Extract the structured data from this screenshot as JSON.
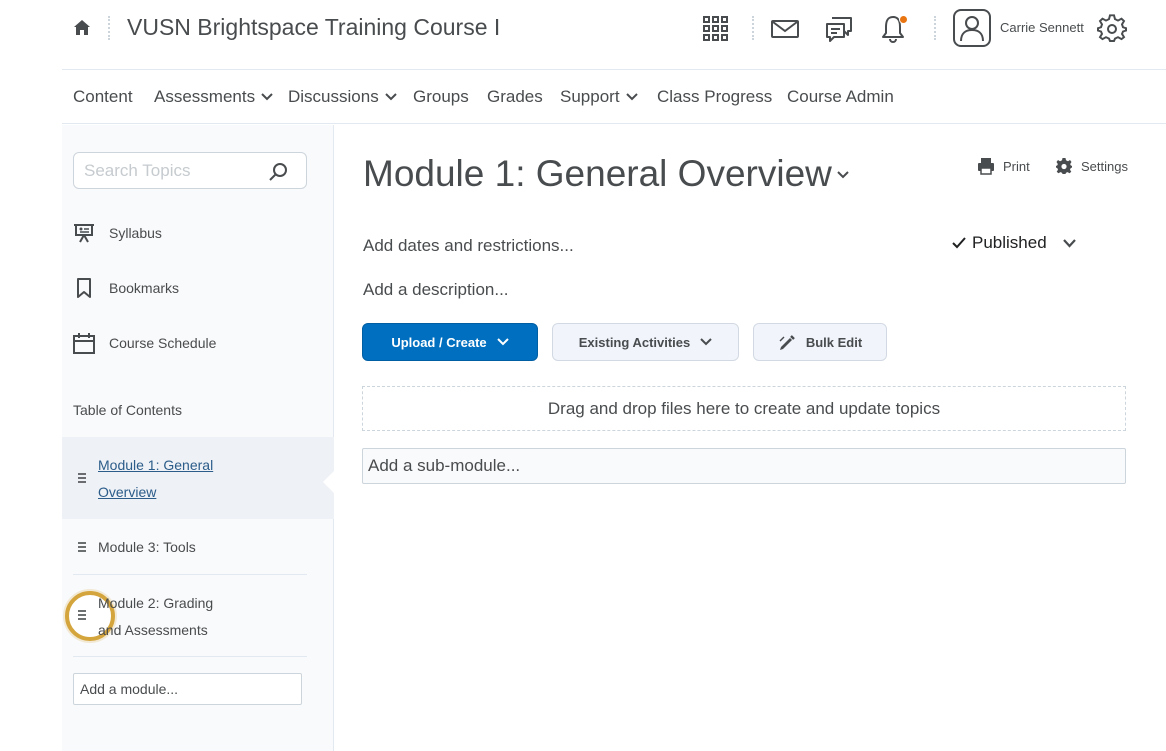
{
  "header": {
    "course_title": "VUSN Brightspace Training Course I",
    "user_name": "Carrie Sennett",
    "notification_color": "#e87511"
  },
  "nav": {
    "items": [
      {
        "label": "Content",
        "has_dropdown": false
      },
      {
        "label": "Assessments",
        "has_dropdown": true
      },
      {
        "label": "Discussions",
        "has_dropdown": true
      },
      {
        "label": "Groups",
        "has_dropdown": false
      },
      {
        "label": "Grades",
        "has_dropdown": false
      },
      {
        "label": "Support",
        "has_dropdown": true
      },
      {
        "label": "Class Progress",
        "has_dropdown": false
      },
      {
        "label": "Course Admin",
        "has_dropdown": false
      }
    ]
  },
  "sidebar": {
    "search_placeholder": "Search Topics",
    "links": [
      {
        "label": "Syllabus",
        "icon": "presentation-icon"
      },
      {
        "label": "Bookmarks",
        "icon": "bookmark-icon"
      },
      {
        "label": "Course Schedule",
        "icon": "calendar-icon"
      }
    ],
    "toc_label": "Table of Contents",
    "modules": [
      {
        "label": "Module 1: General Overview",
        "active": true
      },
      {
        "label": "Module 3: Tools",
        "active": false
      },
      {
        "label": "Module 2: Grading and Assessments",
        "active": false
      }
    ],
    "add_module_label": "Add a module..."
  },
  "main": {
    "title": "Module 1: General Overview",
    "print_label": "Print",
    "settings_label": "Settings",
    "add_dates_label": "Add dates and restrictions...",
    "add_description_label": "Add a description...",
    "status_label": "Published",
    "upload_create_label": "Upload / Create",
    "existing_activities_label": "Existing Activities",
    "bulk_edit_label": "Bulk Edit",
    "dropzone_label": "Drag and drop files here to create and update topics",
    "add_submodule_label": "Add a sub-module..."
  },
  "colors": {
    "primary_button": "#006fbf",
    "focus_ring": "#d5a53d"
  }
}
